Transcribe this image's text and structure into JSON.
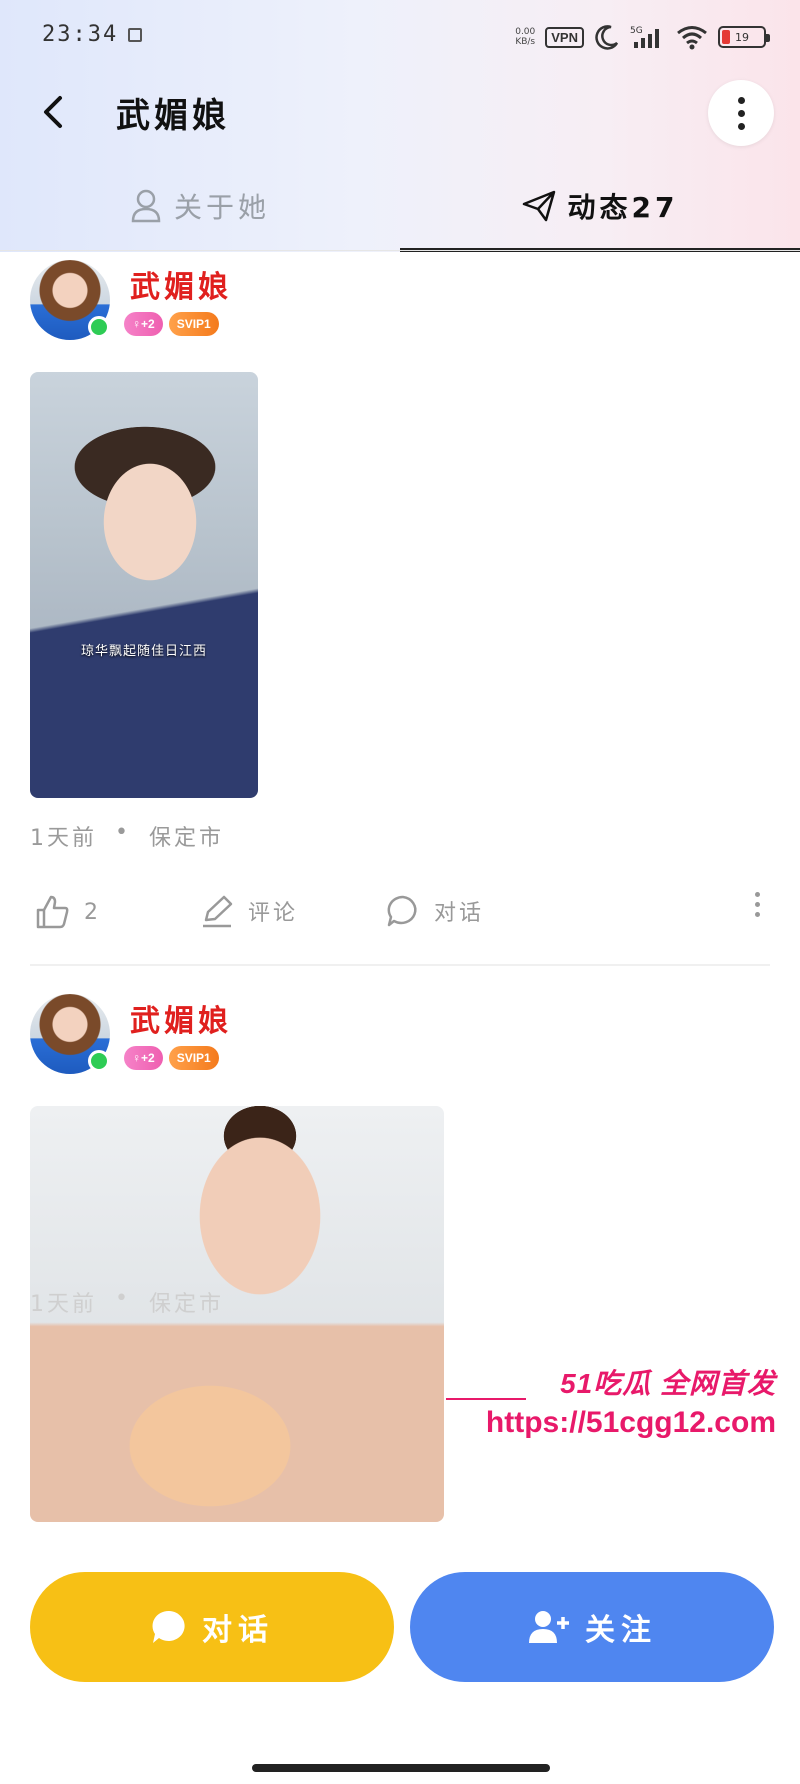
{
  "status_bar": {
    "time": "23:34",
    "net_speed_value": "0.00",
    "net_speed_unit": "KB/s",
    "vpn": "VPN",
    "network": "5G",
    "battery": "19"
  },
  "nav": {
    "title": "武媚娘"
  },
  "tabs": [
    {
      "label": "关于她",
      "active": false
    },
    {
      "label": "动态27",
      "active": true
    }
  ],
  "posts": [
    {
      "author": "武媚娘",
      "level_badge": "♀+2",
      "vip_badge": "SVIP1",
      "photo_caption": "琼华飘起随佳日江西",
      "time": "1天前",
      "location": "保定市",
      "likes": "2",
      "comment_label": "评论",
      "chat_label": "对话"
    },
    {
      "author": "武媚娘",
      "level_badge": "♀+2",
      "vip_badge": "SVIP1",
      "time": "1天前",
      "location": "保定市"
    }
  ],
  "watermark": {
    "line1": "51吃瓜 全网首发",
    "line2": "https://51cgg12.com"
  },
  "bottom": {
    "chat_label": "对话",
    "follow_label": "关注"
  },
  "colors": {
    "name_red": "#e0201e",
    "online_green": "#2ecc55",
    "chat_yellow": "#f7c015",
    "follow_blue": "#4f86f0",
    "watermark_pink": "#e8196a"
  }
}
